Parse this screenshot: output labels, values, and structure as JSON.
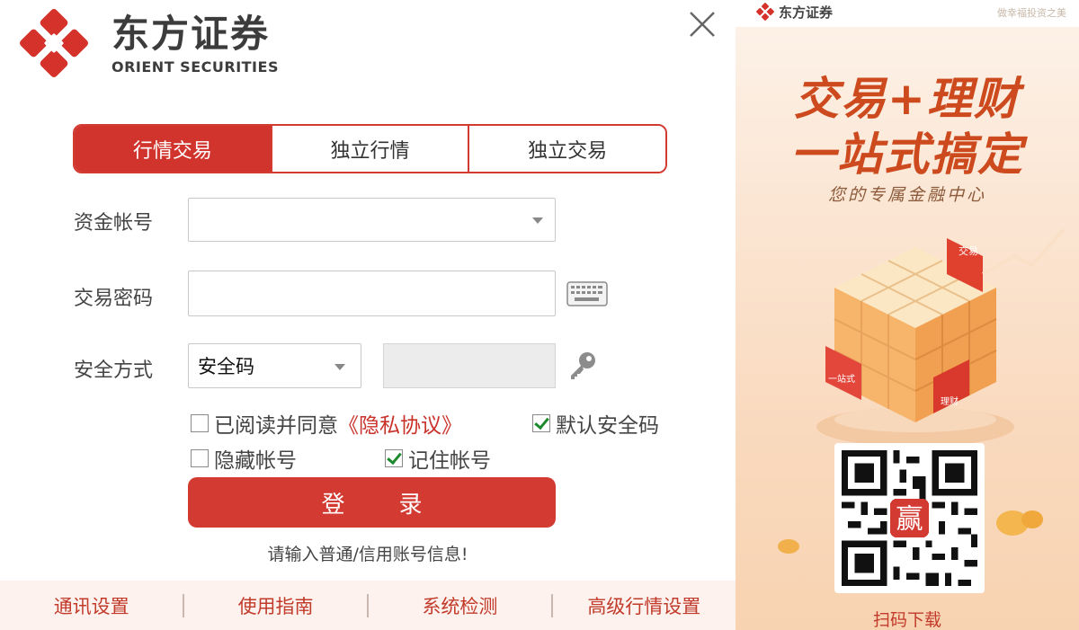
{
  "brand": {
    "name_cn": "东方证券",
    "name_en": "ORIENT SECURITIES"
  },
  "tabs": [
    {
      "label": "行情交易",
      "active": true
    },
    {
      "label": "独立行情",
      "active": false
    },
    {
      "label": "独立交易",
      "active": false
    }
  ],
  "form": {
    "account_label": "资金帐号",
    "account_value": "",
    "password_label": "交易密码",
    "password_value": "",
    "security_label": "安全方式",
    "security_selected": "安全码",
    "security_code_value": ""
  },
  "options": {
    "agree_label": "已阅读并同意",
    "privacy_link": "《隐私协议》",
    "agree_checked": false,
    "default_code_label": "默认安全码",
    "default_code_checked": true,
    "hide_account_label": "隐藏帐号",
    "hide_account_checked": false,
    "remember_account_label": "记住帐号",
    "remember_account_checked": true
  },
  "login_button": "登录",
  "hint": "请输入普通/信用账号信息!",
  "bottom_links": [
    "通讯设置",
    "使用指南",
    "系统检测",
    "高级行情设置"
  ],
  "ad": {
    "logo_text": "东方证券",
    "tagline_small": "做幸福投资之美",
    "headline_1": "交易+理财",
    "headline_2": "一站式搞定",
    "subline": "您的专属金融中心",
    "cube_labels": [
      "交易",
      "一站式",
      "理财"
    ],
    "app_badge": "赢",
    "scan_text": "扫码下载"
  },
  "colors": {
    "accent": "#d33a31",
    "link": "#c13a2a",
    "ad_headline": "#cc4a1e"
  }
}
